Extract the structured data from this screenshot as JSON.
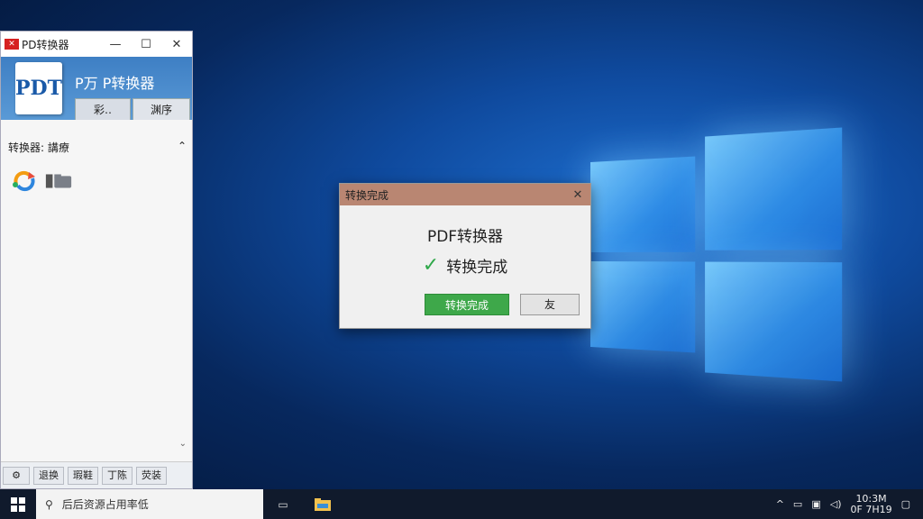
{
  "app": {
    "window_title": "PD转换器",
    "header_title": "P万 P转换器",
    "logo_text": "PDT",
    "tabs": [
      "彩‥",
      "渊序"
    ],
    "path_label": "转换器: 講療",
    "bottom_buttons": [
      "退换",
      "瑕鞋",
      "丁陈",
      "荧装"
    ],
    "controls": {
      "minimize": "—",
      "maximize": "☐",
      "close": "✕"
    }
  },
  "dialog": {
    "title": "转换完成",
    "app_name": "PDF转换器",
    "message": "转换完成",
    "ok_label": "转换完成",
    "cancel_label": "友",
    "close": "✕"
  },
  "taskbar": {
    "search_placeholder": "后后资源占用率低",
    "time": "10:3M",
    "date": "0F 7H19"
  },
  "colors": {
    "dialog_title_bg": "#b98672",
    "ok_green": "#3ea84a",
    "app_header_blue": "#3e7fc4"
  }
}
